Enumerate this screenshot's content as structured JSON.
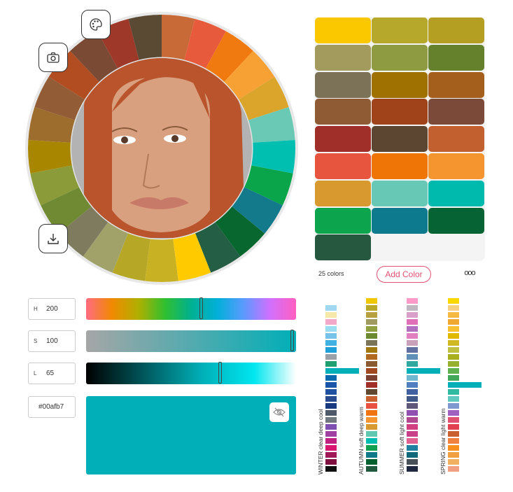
{
  "toolbar": {
    "palette_icon": "palette-icon",
    "camera_icon": "camera-icon",
    "download_icon": "download-icon"
  },
  "wheel": {
    "segments": [
      "#c8b223",
      "#b6a727",
      "#a0a26a",
      "#7f7b5e",
      "#6f8a32",
      "#8b9b3a",
      "#a98600",
      "#9c6d2c",
      "#925d36",
      "#b14d21",
      "#7a4a34",
      "#9e3829",
      "#5a4a34",
      "#c76a37",
      "#e85a3c",
      "#f07a10",
      "#f7a134",
      "#dba52b",
      "#6ac9b4",
      "#00bfb0",
      "#0aa54a",
      "#127a8b",
      "#07672f",
      "#245e44",
      "#ffca00"
    ],
    "portrait_colors": {
      "hair": "#b9542c",
      "skin": "#d9a07f",
      "lip": "#c87a68"
    }
  },
  "swatches": [
    "#fbc800",
    "#b6a82a",
    "#b49f22",
    "#a39b5e",
    "#8f9b40",
    "#66812c",
    "#7b7257",
    "#9e7100",
    "#a55f1d",
    "#8f5b35",
    "#a0421a",
    "#7b4a38",
    "#a02e29",
    "#5d4631",
    "#c3602f",
    "#e8553f",
    "#f07507",
    "#f59530",
    "#d89a2e",
    "#67c8b5",
    "#00bbad",
    "#0ca44c",
    "#0d7b8d",
    "#066434",
    "#25583f"
  ],
  "swatch_count_label": "25 colors",
  "add_color_label": "Add Color",
  "more_label": "ooo",
  "controls": {
    "h_label": "H",
    "h_value": "200",
    "s_label": "S",
    "s_value": "100",
    "l_label": "L",
    "l_value": "65",
    "hex_value": "#00afb7",
    "hue_pos": 0.55,
    "sat_pos": 0.99,
    "light_pos": 0.64,
    "preview_color": "#00afb7"
  },
  "palettes": [
    {
      "label": "WINTER  clear deep cool",
      "colors": [
        "#ffffff",
        "#9fd8f0",
        "#f5e8a8",
        "#f2a8c8",
        "#9adcf0",
        "#76c2e8",
        "#40b0e0",
        "#20a0d8",
        "#9aa0a8",
        "#20a070",
        "#00afb7",
        "#0b6aaf",
        "#1b55a8",
        "#2050a0",
        "#2a4a90",
        "#183880",
        "#4e5a6a",
        "#707880",
        "#8050b0",
        "#a040a0",
        "#c02080",
        "#d81870",
        "#a01858",
        "#801040",
        "#101010"
      ]
    },
    {
      "label": "AUTUMN  soft deep warm",
      "colors": [
        "#f0c800",
        "#b8a828",
        "#b8a040",
        "#a09a60",
        "#90a040",
        "#6e8a30",
        "#7a7558",
        "#a07a10",
        "#b06a20",
        "#8a5a30",
        "#a04820",
        "#7a4030",
        "#a03028",
        "#604830",
        "#c86030",
        "#e85040",
        "#f07510",
        "#f59530",
        "#d89830",
        "#60c8b0",
        "#00bcb0",
        "#10a050",
        "#107888",
        "#056030",
        "#205840"
      ]
    },
    {
      "label": "SUMMER  soft light cool",
      "colors": [
        "#ff9ac8",
        "#c0b8c0",
        "#d8a0c8",
        "#e070b8",
        "#b070c0",
        "#e080c0",
        "#c8a0b8",
        "#6070a0",
        "#6090b8",
        "#30a8a0",
        "#00afb7",
        "#70b8d0",
        "#5080c0",
        "#4060a0",
        "#405888",
        "#605878",
        "#9050b0",
        "#b04890",
        "#d04080",
        "#c84088",
        "#e06090",
        "#2080a0",
        "#106878",
        "#485058",
        "#202840"
      ]
    },
    {
      "label": "SPRING  clear light warm",
      "colors": [
        "#f8d800",
        "#f5d080",
        "#f5b840",
        "#f0a830",
        "#f8c030",
        "#e0b800",
        "#d0b820",
        "#c0c040",
        "#a8b020",
        "#98b030",
        "#60b050",
        "#40a858",
        "#00afb7",
        "#30b8a0",
        "#60c8c0",
        "#8098d0",
        "#a060c0",
        "#e05070",
        "#e04050",
        "#c86030",
        "#f08040",
        "#f89020",
        "#f0a040",
        "#f0b060",
        "#f0a080"
      ]
    }
  ]
}
